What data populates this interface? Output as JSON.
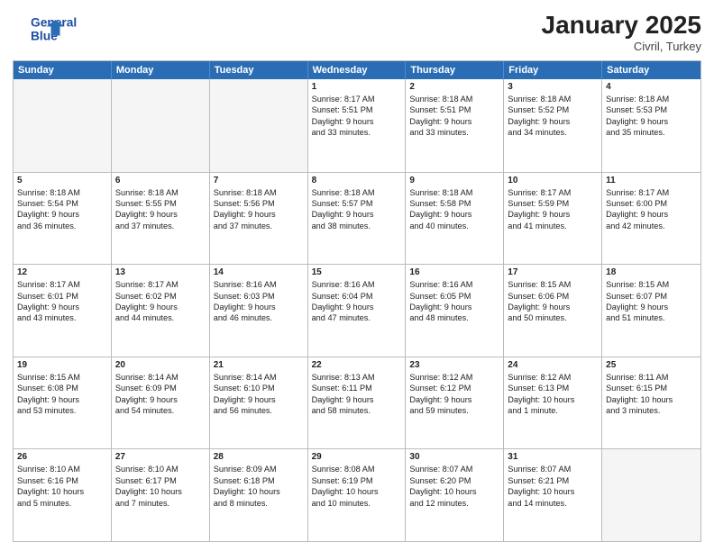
{
  "header": {
    "logo_text_general": "General",
    "logo_text_blue": "Blue",
    "month_year": "January 2025",
    "location": "Civril, Turkey"
  },
  "days_of_week": [
    "Sunday",
    "Monday",
    "Tuesday",
    "Wednesday",
    "Thursday",
    "Friday",
    "Saturday"
  ],
  "rows": [
    [
      {
        "day": "",
        "empty": true
      },
      {
        "day": "",
        "empty": true
      },
      {
        "day": "",
        "empty": true
      },
      {
        "day": "1",
        "sunrise": "Sunrise: 8:17 AM",
        "sunset": "Sunset: 5:51 PM",
        "daylight": "Daylight: 9 hours",
        "daylight2": "and 33 minutes."
      },
      {
        "day": "2",
        "sunrise": "Sunrise: 8:18 AM",
        "sunset": "Sunset: 5:51 PM",
        "daylight": "Daylight: 9 hours",
        "daylight2": "and 33 minutes."
      },
      {
        "day": "3",
        "sunrise": "Sunrise: 8:18 AM",
        "sunset": "Sunset: 5:52 PM",
        "daylight": "Daylight: 9 hours",
        "daylight2": "and 34 minutes."
      },
      {
        "day": "4",
        "sunrise": "Sunrise: 8:18 AM",
        "sunset": "Sunset: 5:53 PM",
        "daylight": "Daylight: 9 hours",
        "daylight2": "and 35 minutes."
      }
    ],
    [
      {
        "day": "5",
        "sunrise": "Sunrise: 8:18 AM",
        "sunset": "Sunset: 5:54 PM",
        "daylight": "Daylight: 9 hours",
        "daylight2": "and 36 minutes."
      },
      {
        "day": "6",
        "sunrise": "Sunrise: 8:18 AM",
        "sunset": "Sunset: 5:55 PM",
        "daylight": "Daylight: 9 hours",
        "daylight2": "and 37 minutes."
      },
      {
        "day": "7",
        "sunrise": "Sunrise: 8:18 AM",
        "sunset": "Sunset: 5:56 PM",
        "daylight": "Daylight: 9 hours",
        "daylight2": "and 37 minutes."
      },
      {
        "day": "8",
        "sunrise": "Sunrise: 8:18 AM",
        "sunset": "Sunset: 5:57 PM",
        "daylight": "Daylight: 9 hours",
        "daylight2": "and 38 minutes."
      },
      {
        "day": "9",
        "sunrise": "Sunrise: 8:18 AM",
        "sunset": "Sunset: 5:58 PM",
        "daylight": "Daylight: 9 hours",
        "daylight2": "and 40 minutes."
      },
      {
        "day": "10",
        "sunrise": "Sunrise: 8:17 AM",
        "sunset": "Sunset: 5:59 PM",
        "daylight": "Daylight: 9 hours",
        "daylight2": "and 41 minutes."
      },
      {
        "day": "11",
        "sunrise": "Sunrise: 8:17 AM",
        "sunset": "Sunset: 6:00 PM",
        "daylight": "Daylight: 9 hours",
        "daylight2": "and 42 minutes."
      }
    ],
    [
      {
        "day": "12",
        "sunrise": "Sunrise: 8:17 AM",
        "sunset": "Sunset: 6:01 PM",
        "daylight": "Daylight: 9 hours",
        "daylight2": "and 43 minutes."
      },
      {
        "day": "13",
        "sunrise": "Sunrise: 8:17 AM",
        "sunset": "Sunset: 6:02 PM",
        "daylight": "Daylight: 9 hours",
        "daylight2": "and 44 minutes."
      },
      {
        "day": "14",
        "sunrise": "Sunrise: 8:16 AM",
        "sunset": "Sunset: 6:03 PM",
        "daylight": "Daylight: 9 hours",
        "daylight2": "and 46 minutes."
      },
      {
        "day": "15",
        "sunrise": "Sunrise: 8:16 AM",
        "sunset": "Sunset: 6:04 PM",
        "daylight": "Daylight: 9 hours",
        "daylight2": "and 47 minutes."
      },
      {
        "day": "16",
        "sunrise": "Sunrise: 8:16 AM",
        "sunset": "Sunset: 6:05 PM",
        "daylight": "Daylight: 9 hours",
        "daylight2": "and 48 minutes."
      },
      {
        "day": "17",
        "sunrise": "Sunrise: 8:15 AM",
        "sunset": "Sunset: 6:06 PM",
        "daylight": "Daylight: 9 hours",
        "daylight2": "and 50 minutes."
      },
      {
        "day": "18",
        "sunrise": "Sunrise: 8:15 AM",
        "sunset": "Sunset: 6:07 PM",
        "daylight": "Daylight: 9 hours",
        "daylight2": "and 51 minutes."
      }
    ],
    [
      {
        "day": "19",
        "sunrise": "Sunrise: 8:15 AM",
        "sunset": "Sunset: 6:08 PM",
        "daylight": "Daylight: 9 hours",
        "daylight2": "and 53 minutes."
      },
      {
        "day": "20",
        "sunrise": "Sunrise: 8:14 AM",
        "sunset": "Sunset: 6:09 PM",
        "daylight": "Daylight: 9 hours",
        "daylight2": "and 54 minutes."
      },
      {
        "day": "21",
        "sunrise": "Sunrise: 8:14 AM",
        "sunset": "Sunset: 6:10 PM",
        "daylight": "Daylight: 9 hours",
        "daylight2": "and 56 minutes."
      },
      {
        "day": "22",
        "sunrise": "Sunrise: 8:13 AM",
        "sunset": "Sunset: 6:11 PM",
        "daylight": "Daylight: 9 hours",
        "daylight2": "and 58 minutes."
      },
      {
        "day": "23",
        "sunrise": "Sunrise: 8:12 AM",
        "sunset": "Sunset: 6:12 PM",
        "daylight": "Daylight: 9 hours",
        "daylight2": "and 59 minutes."
      },
      {
        "day": "24",
        "sunrise": "Sunrise: 8:12 AM",
        "sunset": "Sunset: 6:13 PM",
        "daylight": "Daylight: 10 hours",
        "daylight2": "and 1 minute."
      },
      {
        "day": "25",
        "sunrise": "Sunrise: 8:11 AM",
        "sunset": "Sunset: 6:15 PM",
        "daylight": "Daylight: 10 hours",
        "daylight2": "and 3 minutes."
      }
    ],
    [
      {
        "day": "26",
        "sunrise": "Sunrise: 8:10 AM",
        "sunset": "Sunset: 6:16 PM",
        "daylight": "Daylight: 10 hours",
        "daylight2": "and 5 minutes."
      },
      {
        "day": "27",
        "sunrise": "Sunrise: 8:10 AM",
        "sunset": "Sunset: 6:17 PM",
        "daylight": "Daylight: 10 hours",
        "daylight2": "and 7 minutes."
      },
      {
        "day": "28",
        "sunrise": "Sunrise: 8:09 AM",
        "sunset": "Sunset: 6:18 PM",
        "daylight": "Daylight: 10 hours",
        "daylight2": "and 8 minutes."
      },
      {
        "day": "29",
        "sunrise": "Sunrise: 8:08 AM",
        "sunset": "Sunset: 6:19 PM",
        "daylight": "Daylight: 10 hours",
        "daylight2": "and 10 minutes."
      },
      {
        "day": "30",
        "sunrise": "Sunrise: 8:07 AM",
        "sunset": "Sunset: 6:20 PM",
        "daylight": "Daylight: 10 hours",
        "daylight2": "and 12 minutes."
      },
      {
        "day": "31",
        "sunrise": "Sunrise: 8:07 AM",
        "sunset": "Sunset: 6:21 PM",
        "daylight": "Daylight: 10 hours",
        "daylight2": "and 14 minutes."
      },
      {
        "day": "",
        "empty": true
      }
    ]
  ]
}
